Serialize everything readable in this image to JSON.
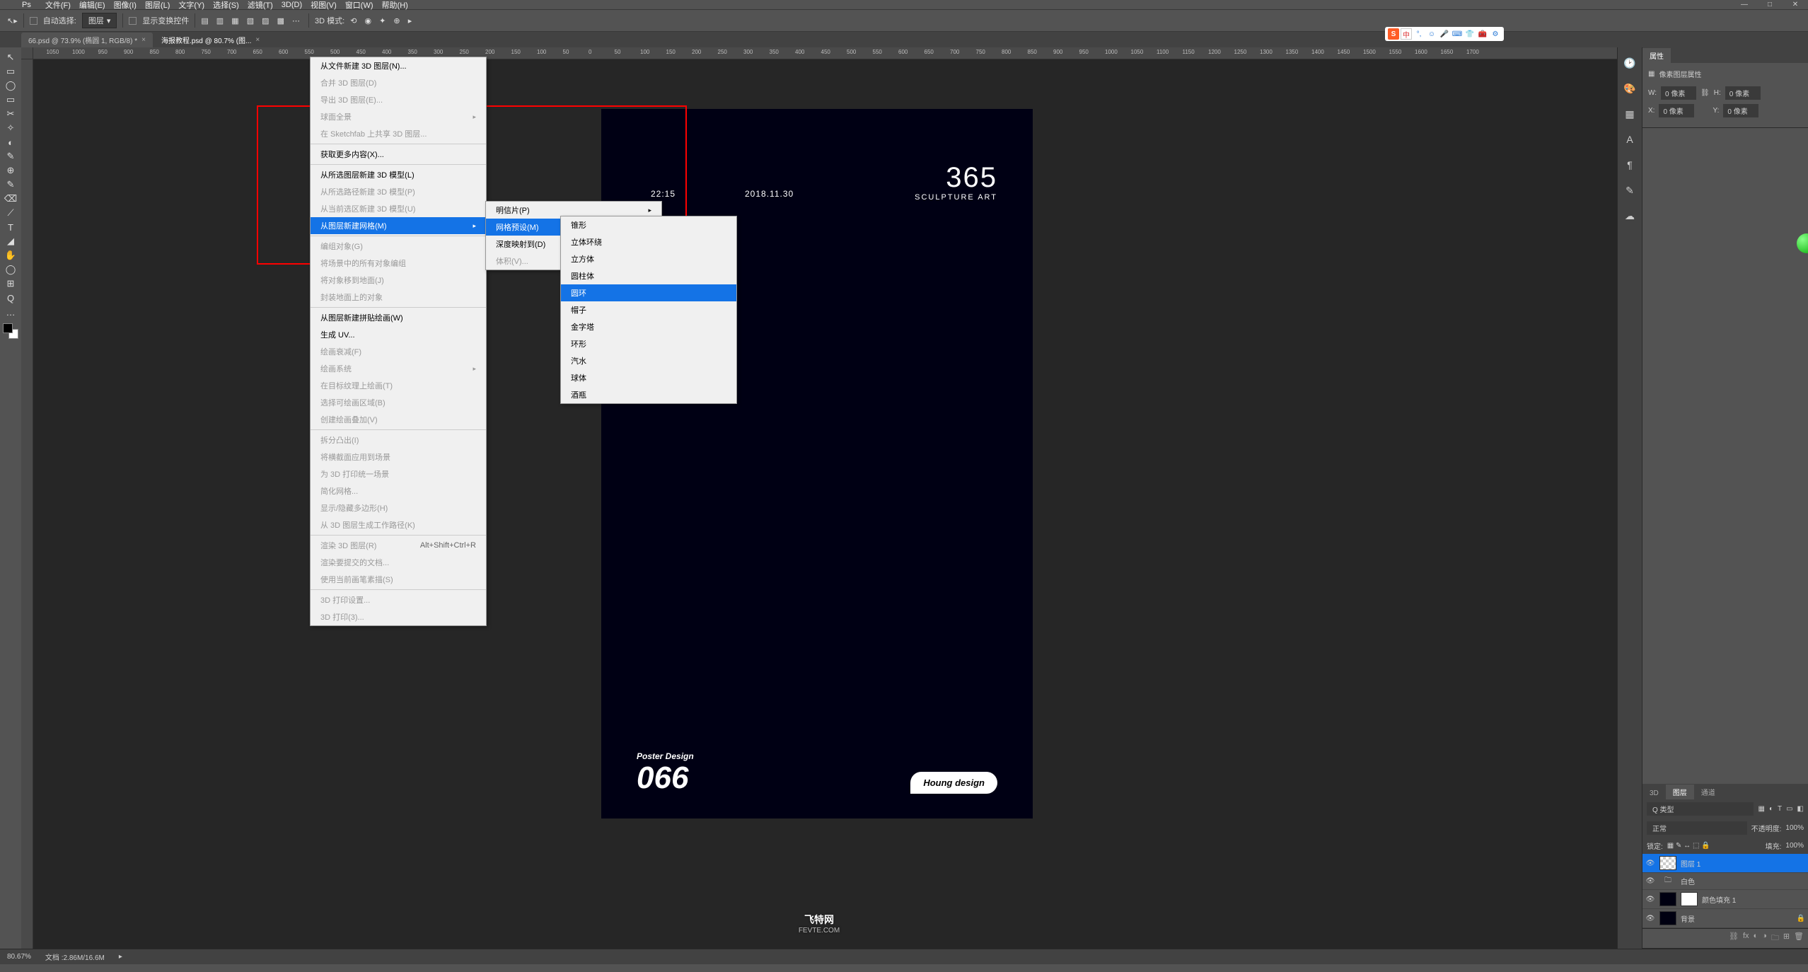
{
  "menubar": [
    "文件(F)",
    "编辑(E)",
    "图像(I)",
    "图层(L)",
    "文字(Y)",
    "选择(S)",
    "滤镜(T)",
    "3D(D)",
    "视图(V)",
    "窗口(W)",
    "帮助(H)"
  ],
  "options": {
    "auto_select_label": "自动选择:",
    "auto_select_target": "图层",
    "show_transform": "显示变换控件",
    "mode_3d_label": "3D 模式:"
  },
  "tabs": [
    {
      "title": "66.psd @ 73.9% (椭圆 1, RGB/8) *"
    },
    {
      "title": "海报教程.psd @ 80.7% (图..."
    }
  ],
  "poster": {
    "time": "22:15",
    "date": "2018.11.30",
    "big": "365",
    "big_sub": "SCULPTURE ART",
    "pd_label": "Poster Design",
    "pd_num": "066",
    "pill": "Houng design"
  },
  "menu3d": {
    "g1": [
      "从文件新建 3D 图层(N)...",
      "合并 3D 图层(D)",
      "导出 3D 图层(E)..."
    ],
    "g2_item": "球面全景",
    "g3": [
      "在 Sketchfab 上共享 3D 图层..."
    ],
    "g4": [
      "获取更多内容(X)..."
    ],
    "g5": [
      "从所选图层新建 3D 模型(L)",
      "从所选路径新建 3D 模型(P)",
      "从当前选区新建 3D 模型(U)"
    ],
    "highlight": "从图层新建网格(M)",
    "g6": [
      "编组对象(G)",
      "将场景中的所有对象编组",
      "将对象移到地面(J)",
      "封装地面上的对象"
    ],
    "g7": [
      "从图层新建拼贴绘画(W)",
      "生成 UV...",
      "绘画衰减(F)"
    ],
    "g8_item": "绘画系统",
    "g9": [
      "在目标纹理上绘画(T)",
      "选择可绘画区域(B)",
      "创建绘画叠加(V)"
    ],
    "g10": [
      "拆分凸出(I)",
      "将横截面应用到场景",
      "为 3D 打印统一场景",
      "简化网格...",
      "显示/隐藏多边形(H)",
      "从 3D 图层生成工作路径(K)"
    ],
    "g11_item": "渲染 3D 图层(R)",
    "g11_shortcut": "Alt+Shift+Ctrl+R",
    "g12": [
      "渲染要提交的文档...",
      "使用当前画笔素描(S)"
    ],
    "g13": [
      "3D 打印设置...",
      "3D 打印(3)..."
    ]
  },
  "submenu": {
    "items": [
      "明信片(P)",
      "网格预设(M)",
      "深度映射到(D)",
      "体积(V)..."
    ],
    "highlight_index": 1
  },
  "submenu2": [
    "锥形",
    "立体环绕",
    "立方体",
    "圆柱体",
    "圆环",
    "帽子",
    "金字塔",
    "环形",
    "汽水",
    "球体",
    "酒瓶"
  ],
  "submenu2_highlight_index": 4,
  "properties": {
    "title": "属性",
    "doc_props": "像素图层属性",
    "w_label": "W:",
    "w_val": "0 像素",
    "h_label": "H:",
    "h_val": "0 像素",
    "x_label": "X:",
    "x_val": "0 像素",
    "y_label": "Y:",
    "y_val": "0 像素",
    "link_icon": "⛓"
  },
  "layers_panel": {
    "tabs": [
      "3D",
      "图层",
      "通道"
    ],
    "active_tab": 1,
    "kind_label": "Q 类型",
    "blend_mode": "正常",
    "opacity_label": "不透明度:",
    "opacity_val": "100%",
    "lock_label": "锁定:",
    "fill_label": "填充:",
    "fill_val": "100%",
    "layers": [
      {
        "name": "图层 1",
        "thumb": "checker",
        "selected": true
      },
      {
        "name": "白色",
        "thumb": "white",
        "folder": true
      },
      {
        "name": "颜色填充 1",
        "thumb": "black",
        "mask": true
      },
      {
        "name": "背景",
        "thumb": "black",
        "locked": true
      }
    ]
  },
  "status": {
    "zoom": "80.67%",
    "doc_size": "文档 :2.86M/16.6M"
  },
  "ruler_ticks": [
    "0",
    "50",
    "100",
    "150",
    "200",
    "250",
    "300",
    "350",
    "400",
    "450",
    "500",
    "550",
    "600",
    "650",
    "700",
    "750",
    "800",
    "850",
    "900",
    "950",
    "1000",
    "1050",
    "1100",
    "1150",
    "1200",
    "1250",
    "1300",
    "1350",
    "1400",
    "1450",
    "1500",
    "1550",
    "1600",
    "1650",
    "1700"
  ],
  "watermark": {
    "main": "飞特网",
    "sub": "FEVTE.COM"
  },
  "tool_icons": [
    "↖",
    "▭",
    "◯",
    "▭",
    "✂",
    "✧",
    "◐",
    "✎",
    "⊕",
    "✎",
    "⌫",
    "⟋",
    "T",
    "◢",
    "✋",
    "◯",
    "⊞",
    "Q",
    "↔",
    "⤢",
    "…"
  ]
}
